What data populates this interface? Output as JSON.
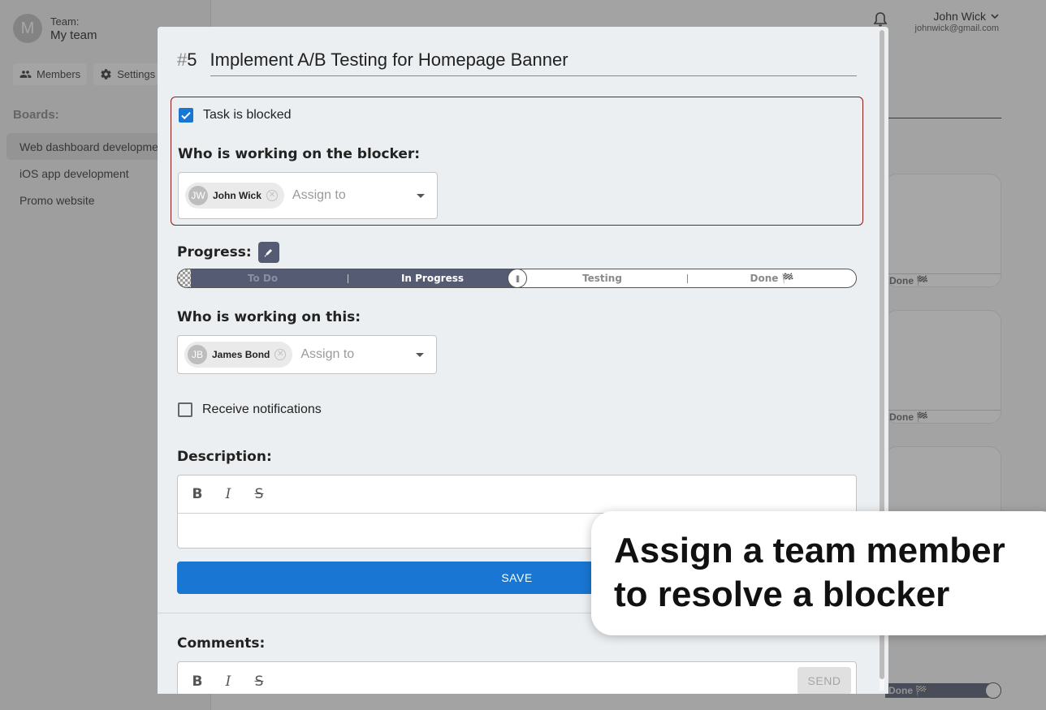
{
  "sidebar": {
    "team_label": "Team:",
    "team_name": "My team",
    "team_initial": "M",
    "members_label": "Members",
    "settings_label": "Settings",
    "boards_label": "Boards:",
    "boards": [
      {
        "label": "Web dashboard development"
      },
      {
        "label": "iOS app development"
      },
      {
        "label": "Promo website"
      }
    ]
  },
  "topbar": {
    "user_name": "John Wick",
    "user_email": "johnwick@gmail.com"
  },
  "background_cards": {
    "done_label": "Done 🏁"
  },
  "modal": {
    "task_hash": "#",
    "task_number": "5",
    "task_title": "Implement A/B Testing for Homepage Banner",
    "blocked": {
      "checkbox_label": "Task is blocked",
      "checked": true,
      "section_label": "Who is working on the blocker:",
      "assignee_initials": "JW",
      "assignee_name": "John Wick",
      "placeholder": "Assign to"
    },
    "progress": {
      "label": "Progress:",
      "stages": [
        "To Do",
        "In Progress",
        "Testing",
        "Done 🏁"
      ],
      "current_stage": "In Progress",
      "value_percent": 50,
      "knob_glyph": "|||"
    },
    "assignees": {
      "section_label": "Who is working on this:",
      "assignee_initials": "JB",
      "assignee_name": "James Bond",
      "placeholder": "Assign to"
    },
    "notifications": {
      "label": "Receive notifications",
      "checked": false
    },
    "description": {
      "label": "Description:",
      "toolbar": {
        "bold": "B",
        "italic": "I",
        "strike": "S"
      }
    },
    "save_label": "SAVE",
    "comments": {
      "label": "Comments:",
      "toolbar": {
        "bold": "B",
        "italic": "I",
        "strike": "S"
      },
      "send_label": "SEND"
    }
  },
  "callout": {
    "line1": "Assign a team member",
    "line2": "to resolve a blocker"
  },
  "colors": {
    "primary": "#1976d2",
    "blocker_border": "#8b1a1a",
    "progress_fill": "#555b72"
  }
}
